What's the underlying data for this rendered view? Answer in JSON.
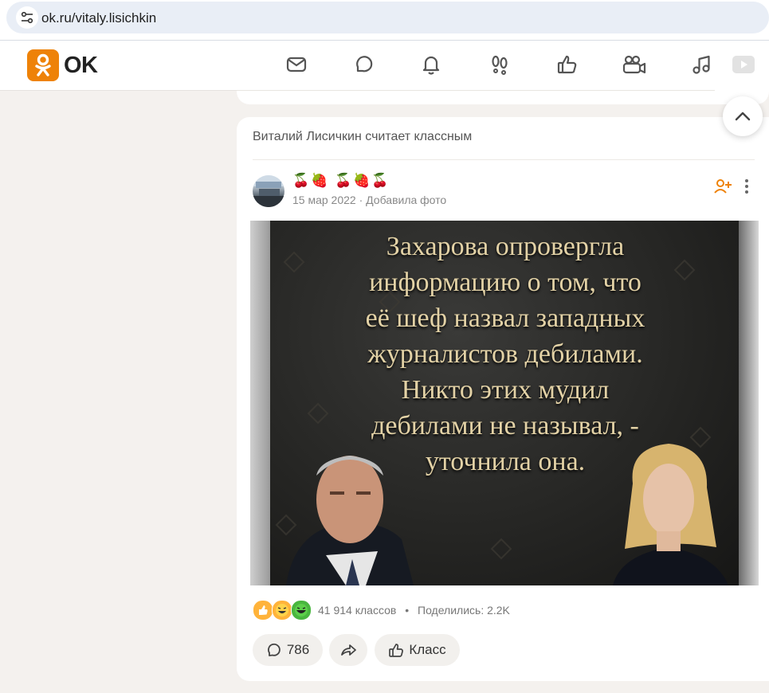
{
  "browser": {
    "url": "ok.ru/vitaly.lisichkin"
  },
  "header": {
    "logo_text": "OK",
    "brand_color": "#ee8208",
    "nav_icons": [
      "messages-icon",
      "discussions-icon",
      "notifications-icon",
      "guests-icon",
      "events-icon",
      "video-icon",
      "music-icon",
      "videos-icon"
    ]
  },
  "post": {
    "header": "Виталий Лисичкин считает классным",
    "author_emojis": "🍒🍓 🍒🍓🍒",
    "date": "15 мар 2022",
    "separator": "·",
    "action": "Добавила фото",
    "photo_caption": "Захарова опровергла\nинформацию о том, что\nеё шеф назвал западных\nжурналистов дебилами.\nНикто этих мудил\nдебилами не называл, -\nуточнила она.",
    "reaction_icons": [
      "like-reaction-icon",
      "laugh-reaction-icon",
      "lol-reaction-icon"
    ],
    "likes_count": "41 914 классов",
    "stats_separator": "•",
    "shares": "Поделились: 2.2K",
    "comments_count": "786",
    "class_label": "Класс"
  }
}
